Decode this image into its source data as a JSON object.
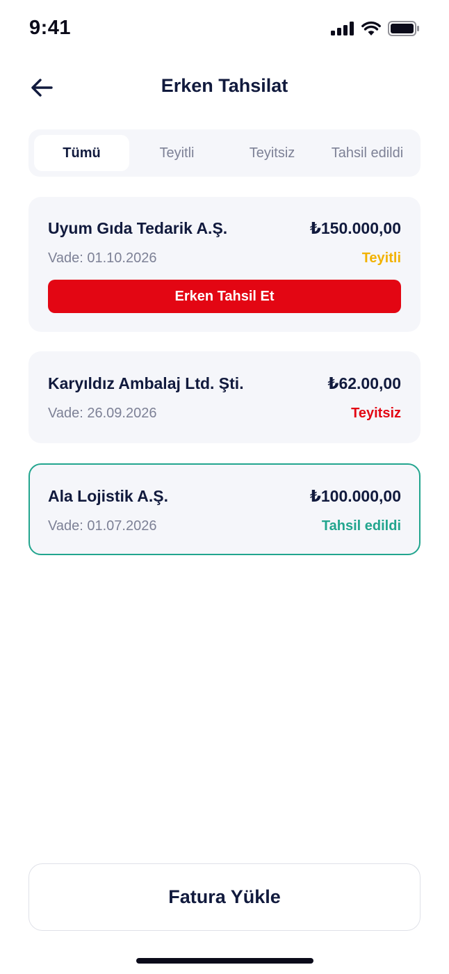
{
  "status_bar": {
    "time": "9:41"
  },
  "header": {
    "title": "Erken Tahsilat"
  },
  "tabs": [
    {
      "label": "Tümü",
      "active": true
    },
    {
      "label": "Teyitli",
      "active": false
    },
    {
      "label": "Teyitsiz",
      "active": false
    },
    {
      "label": "Tahsil edildi",
      "active": false
    }
  ],
  "invoices": [
    {
      "company": "Uyum Gıda Tedarik A.Ş.",
      "amount": "₺150.000,00",
      "due": "Vade: 01.10.2026",
      "status": "Teyitli",
      "status_color": "#f2b200",
      "action_label": "Erken Tahsil Et"
    },
    {
      "company": "Karyıldız Ambalaj Ltd. Şti.",
      "amount": "₺62.00,00",
      "due": "Vade: 26.09.2026",
      "status": "Teyitsiz",
      "status_color": "#e30613"
    },
    {
      "company": "Ala Lojistik A.Ş.",
      "amount": "₺100.000,00",
      "due": "Vade: 01.07.2026",
      "status": "Tahsil edildi",
      "status_color": "#22a58e",
      "selected": true
    }
  ],
  "footer": {
    "upload_label": "Fatura Yükle"
  },
  "colors": {
    "primary_text": "#111a3d",
    "accent_red": "#e30613",
    "accent_green": "#22a58e",
    "accent_yellow": "#f2b200"
  }
}
